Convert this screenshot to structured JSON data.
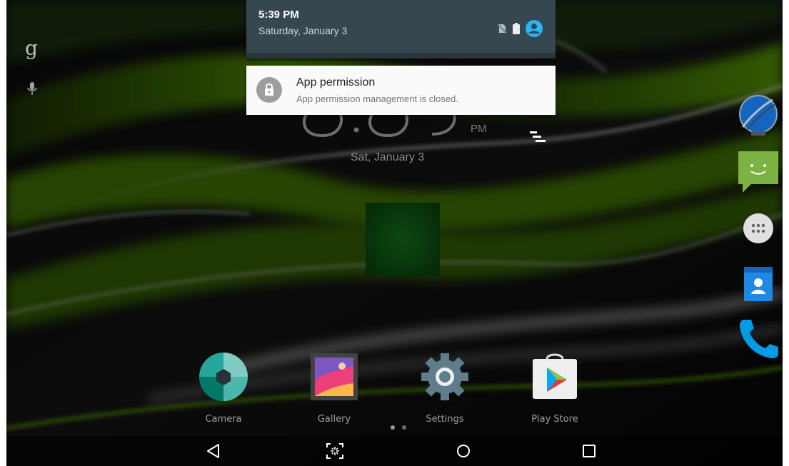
{
  "notification_shade": {
    "time": "5:39 PM",
    "date": "Saturday, January 3",
    "status_icons": [
      "no-sim-icon",
      "battery-icon",
      "user-account-icon"
    ]
  },
  "notification": {
    "icon": "lock-icon",
    "title": "App permission",
    "text": "App permission management is closed."
  },
  "search_bar": {
    "icons": [
      "google-icon",
      "microphone-icon"
    ],
    "google_letter": "g"
  },
  "clock_widget": {
    "ampm": "PM",
    "date": "Sat, January 3"
  },
  "right_dock": {
    "items": [
      {
        "name": "browser",
        "icon": "globe-icon"
      },
      {
        "name": "messaging",
        "icon": "messaging-icon"
      },
      {
        "name": "all-apps",
        "icon": "apps-grid-icon"
      },
      {
        "name": "contacts",
        "icon": "contacts-icon"
      },
      {
        "name": "phone",
        "icon": "phone-icon"
      }
    ]
  },
  "apps": [
    {
      "label": "Camera",
      "icon": "camera-icon"
    },
    {
      "label": "Gallery",
      "icon": "gallery-icon"
    },
    {
      "label": "Settings",
      "icon": "settings-icon"
    },
    {
      "label": "Play Store",
      "icon": "play-store-icon"
    }
  ],
  "page_indicator": {
    "pages": 2,
    "current": 1
  },
  "nav_bar": {
    "buttons": [
      "back-icon",
      "screenshot-icon",
      "home-icon",
      "recents-icon"
    ]
  },
  "colors": {
    "shade_background": "#37474f",
    "accent_cyan": "#29b6f6",
    "wallpaper_green": "#6fbf00",
    "notification_card": "#fafafa"
  }
}
